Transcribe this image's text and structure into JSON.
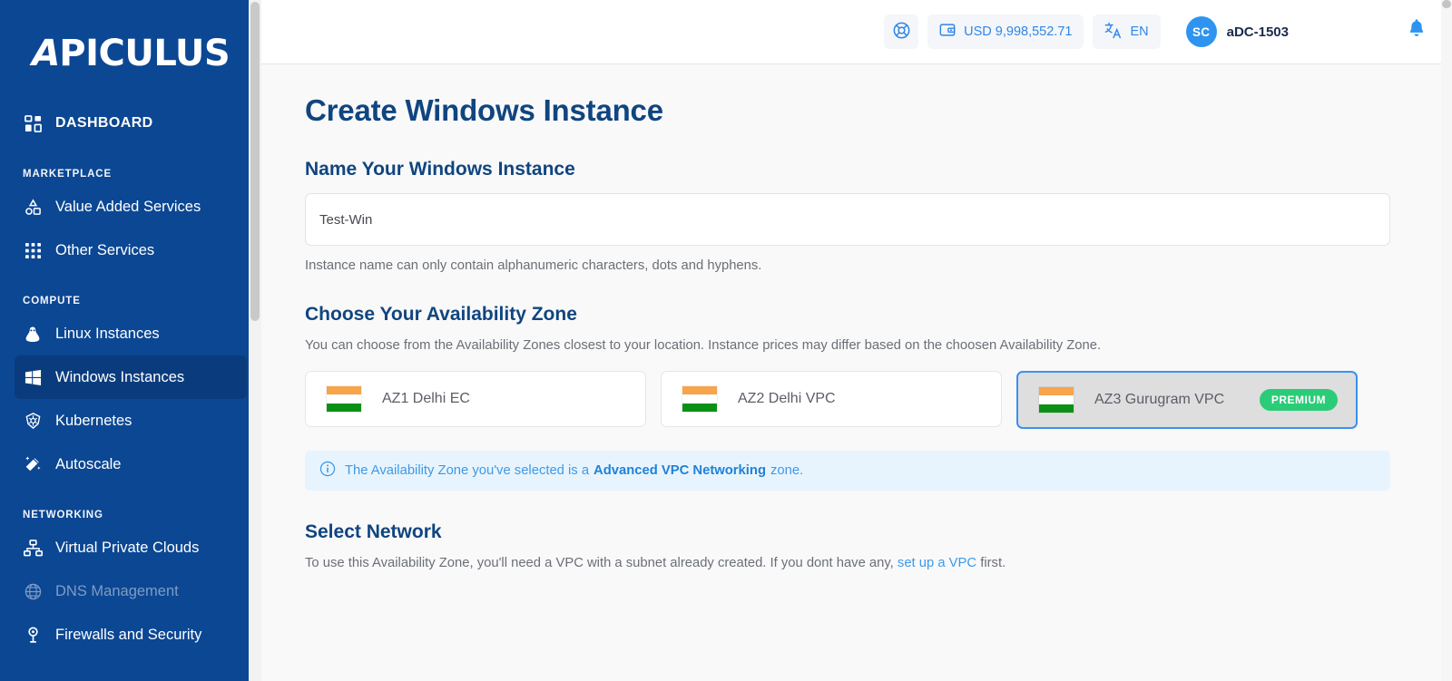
{
  "brand": {
    "name": "APICULUS"
  },
  "colors": {
    "sidebar_bg": "#0b4793",
    "sidebar_active": "#0a3c7d",
    "accent_blue": "#2f86e8",
    "heading_blue": "#10457f",
    "premium_green": "#2bcc78",
    "alert_bg": "#e8f4fd",
    "selected_border": "#3c90f0"
  },
  "sidebar": {
    "items": [
      {
        "label": "DASHBOARD",
        "icon": "grid-dashboard-icon",
        "type": "item",
        "state": "default"
      },
      {
        "label": "MARKETPLACE",
        "type": "section"
      },
      {
        "label": "Value Added Services",
        "icon": "shapes-icon",
        "type": "item",
        "state": "default"
      },
      {
        "label": "Other Services",
        "icon": "apps-grid-icon",
        "type": "item",
        "state": "default"
      },
      {
        "label": "COMPUTE",
        "type": "section"
      },
      {
        "label": "Linux Instances",
        "icon": "tux-penguin-icon",
        "type": "item",
        "state": "default"
      },
      {
        "label": "Windows Instances",
        "icon": "windows-icon",
        "type": "item",
        "state": "active"
      },
      {
        "label": "Kubernetes",
        "icon": "kubernetes-icon",
        "type": "item",
        "state": "default"
      },
      {
        "label": "Autoscale",
        "icon": "magic-wand-icon",
        "type": "item",
        "state": "default"
      },
      {
        "label": "NETWORKING",
        "type": "section"
      },
      {
        "label": "Virtual Private Clouds",
        "icon": "network-nodes-icon",
        "type": "item",
        "state": "default"
      },
      {
        "label": "DNS Management",
        "icon": "globe-icon",
        "type": "item",
        "state": "disabled"
      },
      {
        "label": "Firewalls and Security",
        "icon": "shield-pin-icon",
        "type": "item",
        "state": "default"
      }
    ]
  },
  "topbar": {
    "support_icon": "lifebuoy-icon",
    "wallet_icon": "wallet-icon",
    "wallet_balance": "USD 9,998,552.71",
    "language_icon": "translate-icon",
    "language": "EN",
    "avatar_initials": "SC",
    "username": "aDC-1503",
    "bell_icon": "bell-icon"
  },
  "page": {
    "title": "Create Windows Instance"
  },
  "name_section": {
    "title": "Name Your Windows Instance",
    "value": "Test-Win",
    "placeholder": "Test-Win",
    "helper": "Instance name can only contain alphanumeric characters, dots and hyphens."
  },
  "az_section": {
    "title": "Choose Your Availability Zone",
    "subtitle": "You can choose from the Availability Zones closest to your location. Instance prices may differ based on the choosen Availability Zone.",
    "zones": [
      {
        "label": "AZ1 Delhi EC",
        "flag": "india-flag-icon",
        "selected": false,
        "badge": ""
      },
      {
        "label": "AZ2 Delhi VPC",
        "flag": "india-flag-icon",
        "selected": false,
        "badge": ""
      },
      {
        "label": "AZ3 Gurugram VPC",
        "flag": "india-flag-icon",
        "selected": true,
        "badge": "PREMIUM"
      }
    ]
  },
  "alert": {
    "icon": "info-circle-icon",
    "prefix": "The Availability Zone you've selected is a",
    "emphasis": "Advanced VPC Networking",
    "suffix": "zone."
  },
  "network_section": {
    "title": "Select Network",
    "text_before": "To use this Availability Zone, you'll need a VPC with a subnet already created. If you dont have any,",
    "link": "set up a VPC",
    "text_after": "first."
  }
}
